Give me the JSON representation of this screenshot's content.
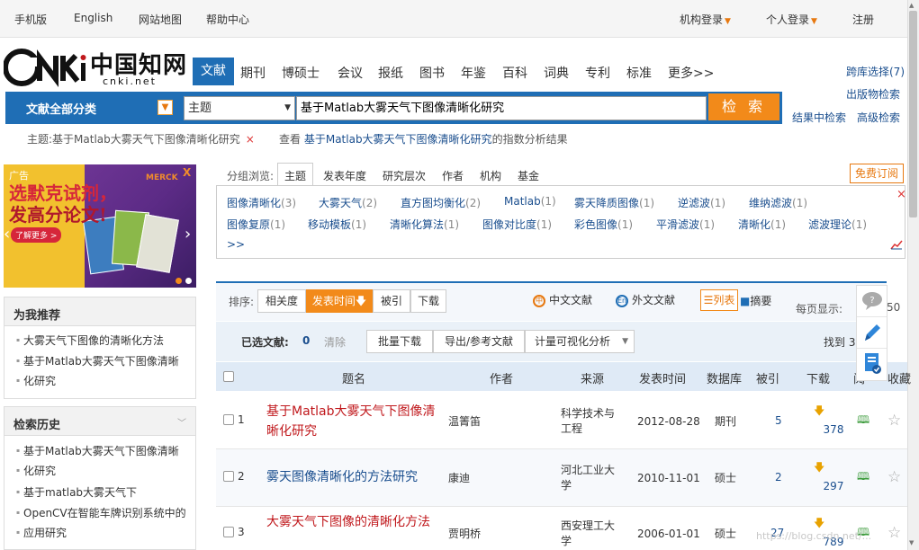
{
  "topbar": {
    "mobile": "手机版",
    "english": "English",
    "sitemap": "网站地图",
    "help": "帮助中心",
    "org_login": "机构登录",
    "personal_login": "个人登录",
    "register": "注册"
  },
  "logo": {
    "brand": "中国知网",
    "url_text": "cnki.net"
  },
  "nav": {
    "tabs": [
      "文献",
      "期刊",
      "博硕士",
      "会议",
      "报纸",
      "图书",
      "年鉴",
      "百科",
      "词典",
      "专利",
      "标准",
      "更多>>"
    ],
    "cross_db": "跨库选择(7)",
    "publication_search": "出版物检索",
    "in_result": "结果中检索",
    "advanced": "高级检索"
  },
  "search": {
    "category": "文献全部分类",
    "field": "主题",
    "query": "基于Matlab大雾天气下图像清晰化研究",
    "button": "检 索"
  },
  "condition": {
    "label": "主题:基于Matlab大雾天气下图像清晰化研究",
    "view_prefix": "查看",
    "view_keyword": "基于Matlab大雾天气下图像清晰化研究",
    "view_suffix": "的指数分析结果"
  },
  "ad": {
    "tag": "广告",
    "line1": "选默克试剂，",
    "line2": "发高分论文!",
    "more": "了解更多 >",
    "brand": "MERCK"
  },
  "recommend": {
    "title": "为我推荐",
    "items": [
      "大雾天气下图像的清晰化方法",
      "基于Matlab大雾天气下图像清晰",
      "化研究"
    ]
  },
  "history": {
    "title": "检索历史",
    "items": [
      "基于Matlab大雾天气下图像清晰",
      "化研究",
      "基于matlab大雾天气下",
      "OpenCV在智能车牌识别系统中的",
      "应用研究"
    ]
  },
  "group": {
    "label": "分组浏览:",
    "tabs": [
      "主题",
      "发表年度",
      "研究层次",
      "作者",
      "机构",
      "基金"
    ],
    "subscribe": "免费订阅",
    "tags": [
      {
        "name": "图像清晰化",
        "count": "(3)"
      },
      {
        "name": "大雾天气",
        "count": "(2)"
      },
      {
        "name": "直方图均衡化",
        "count": "(2)"
      },
      {
        "name": "Matlab",
        "count": "(1)"
      },
      {
        "name": "雾天降质图像",
        "count": "(1)"
      },
      {
        "name": "逆滤波",
        "count": "(1)"
      },
      {
        "name": "维纳滤波",
        "count": "(1)"
      },
      {
        "name": "图像复原",
        "count": "(1)"
      },
      {
        "name": "移动模板",
        "count": "(1)"
      },
      {
        "name": "清晰化算法",
        "count": "(1)"
      },
      {
        "name": "图像对比度",
        "count": "(1)"
      },
      {
        "name": "彩色图像",
        "count": "(1)"
      },
      {
        "name": "平滑滤波",
        "count": "(1)"
      },
      {
        "name": "清晰化",
        "count": "(1)"
      },
      {
        "name": "滤波理论",
        "count": "(1)"
      }
    ],
    "more": ">>"
  },
  "sort": {
    "label": "排序:",
    "options": [
      "相关度",
      "发表时间",
      "被引",
      "下载"
    ],
    "zh_docs": "中文文献",
    "en_docs": "外文文献",
    "view_list": "列表",
    "view_abstract": "摘要",
    "per_page_label": "每页显示:",
    "per_page_value": "50"
  },
  "selection": {
    "label": "已选文献:",
    "count": "0",
    "clear": "清除",
    "batch_download": "批量下载",
    "export": "导出/参考文献",
    "visual": "计量可视化分析",
    "found": "找到 3"
  },
  "table": {
    "headers": [
      "题名",
      "作者",
      "来源",
      "发表时间",
      "数据库",
      "被引",
      "下载",
      "阅",
      "收藏"
    ],
    "rows": [
      {
        "no": "1",
        "title": "基于Matlab大雾天气下图像清晰化研究",
        "author": "温箐笛",
        "source": "科学技术与工程",
        "date": "2012-08-28",
        "db": "期刊",
        "cite": "5",
        "download": "378"
      },
      {
        "no": "2",
        "title": "雾天图像清晰化的方法研究",
        "author": "康迪",
        "source": "河北工业大学",
        "date": "2010-11-01",
        "db": "硕士",
        "cite": "2",
        "download": "297"
      },
      {
        "no": "3",
        "title": "大雾天气下图像的清晰化方法",
        "author": "贾明桥",
        "source": "西安理工大学",
        "date": "2006-01-01",
        "db": "硕士",
        "cite": "27",
        "download": "789"
      }
    ]
  },
  "watermark": "https://blog.csdn.net/..."
}
